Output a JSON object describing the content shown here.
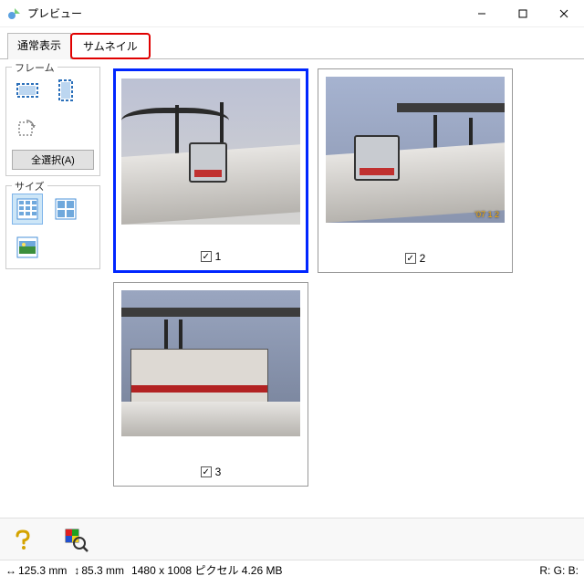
{
  "window": {
    "title": "プレビュー"
  },
  "tabs": {
    "normal": "通常表示",
    "thumbnail": "サムネイル"
  },
  "side": {
    "frame": {
      "title": "フレーム",
      "select_all": "全選択(A)"
    },
    "size": {
      "title": "サイズ"
    }
  },
  "thumbnails": [
    {
      "label": "1",
      "checked": true,
      "selected": true
    },
    {
      "label": "2",
      "checked": true,
      "selected": false
    },
    {
      "label": "3",
      "checked": true,
      "selected": false
    }
  ],
  "status": {
    "width": "125.3 mm",
    "height": "85.3 mm",
    "resolution": "1480 x 1008 ピクセル 4.26 MB",
    "rgb": "R: G: B:"
  },
  "colors": {
    "select_border": "#0026ff",
    "highlight_border": "#e00000"
  }
}
